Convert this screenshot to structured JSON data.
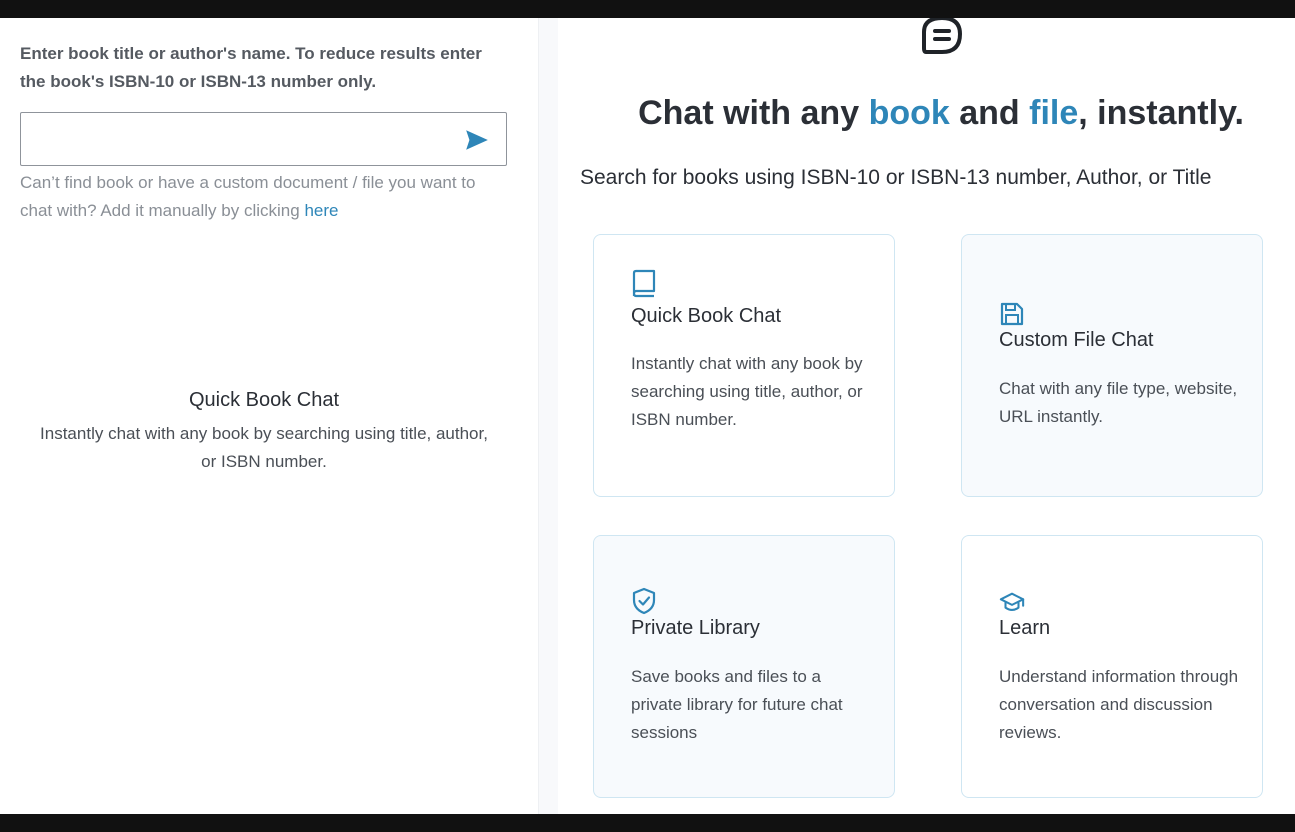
{
  "search": {
    "instructions": "Enter book title or author's name. To reduce results enter the book's ISBN-10 or ISBN-13 number only.",
    "input_value": "",
    "helper_text": "Can’t find book or have a custom document / file you want to chat with? Add it manually by clicking",
    "helper_link": "here",
    "send_icon": "send-icon"
  },
  "left_feature": {
    "title": "Quick Book Chat",
    "description": "Instantly chat with any book by searching using title, author, or ISBN number."
  },
  "hero": {
    "title_prefix": "Chat with any",
    "title_book": "book",
    "title_and": "and",
    "title_file": "file",
    "title_suffix": ", instantly.",
    "subtitle": "Search for books using ISBN-10 or ISBN-13 number, Author, or Title",
    "logo_icon": "chat-bubble-icon"
  },
  "cards": [
    {
      "icon": "book-icon",
      "title": "Quick Book Chat",
      "description": "Instantly chat with any book by searching using title, author, or ISBN number."
    },
    {
      "icon": "floppy-disk-icon",
      "title": "Custom File Chat",
      "description": "Chat with any file type, website, URL instantly."
    },
    {
      "icon": "shield-check-icon",
      "title": "Private Library",
      "description": "Save books and files to a private library for future chat sessions"
    },
    {
      "icon": "graduation-cap-icon",
      "title": "Learn",
      "description": "Understand information through conversation and discussion reviews."
    }
  ],
  "colors": {
    "accent": "#2e86b8",
    "text": "#2b2f36",
    "card_border": "#cfe6f2",
    "card_tint": "#f7fafd"
  }
}
